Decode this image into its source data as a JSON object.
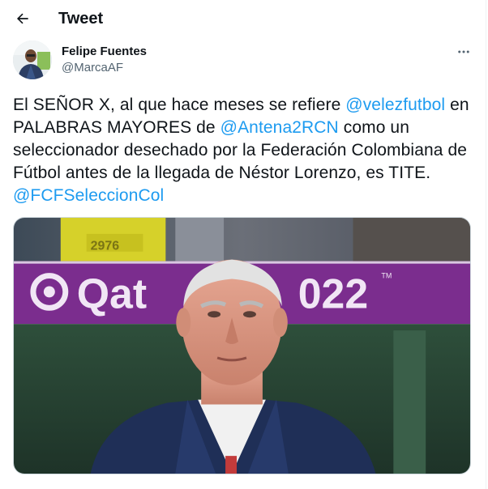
{
  "header": {
    "title": "Tweet"
  },
  "author": {
    "name": "Felipe Fuentes",
    "handle": "@MarcaAF"
  },
  "tweet": {
    "segments": [
      {
        "text": "El SEÑOR X, al que hace meses se refiere ",
        "type": "text"
      },
      {
        "text": "@velezfutbol",
        "type": "mention"
      },
      {
        "text": " en PALABRAS MAYORES de ",
        "type": "text"
      },
      {
        "text": "@Antena2RCN",
        "type": "mention"
      },
      {
        "text": " como un seleccionador desechado por la Federación Colombiana de Fútbol antes de la llegada de Néstor Lorenzo, es TITE. ",
        "type": "text"
      },
      {
        "text": "@FCFSeleccionCol",
        "type": "mention"
      }
    ]
  },
  "media": {
    "banner_text": "Qat",
    "banner_year": "022",
    "banner_tm": "TM",
    "shirt_text": "2976"
  },
  "colors": {
    "mention": "#1d9bf0",
    "text": "#0f1419",
    "secondary": "#536471",
    "banner": "#7b2d8e"
  }
}
